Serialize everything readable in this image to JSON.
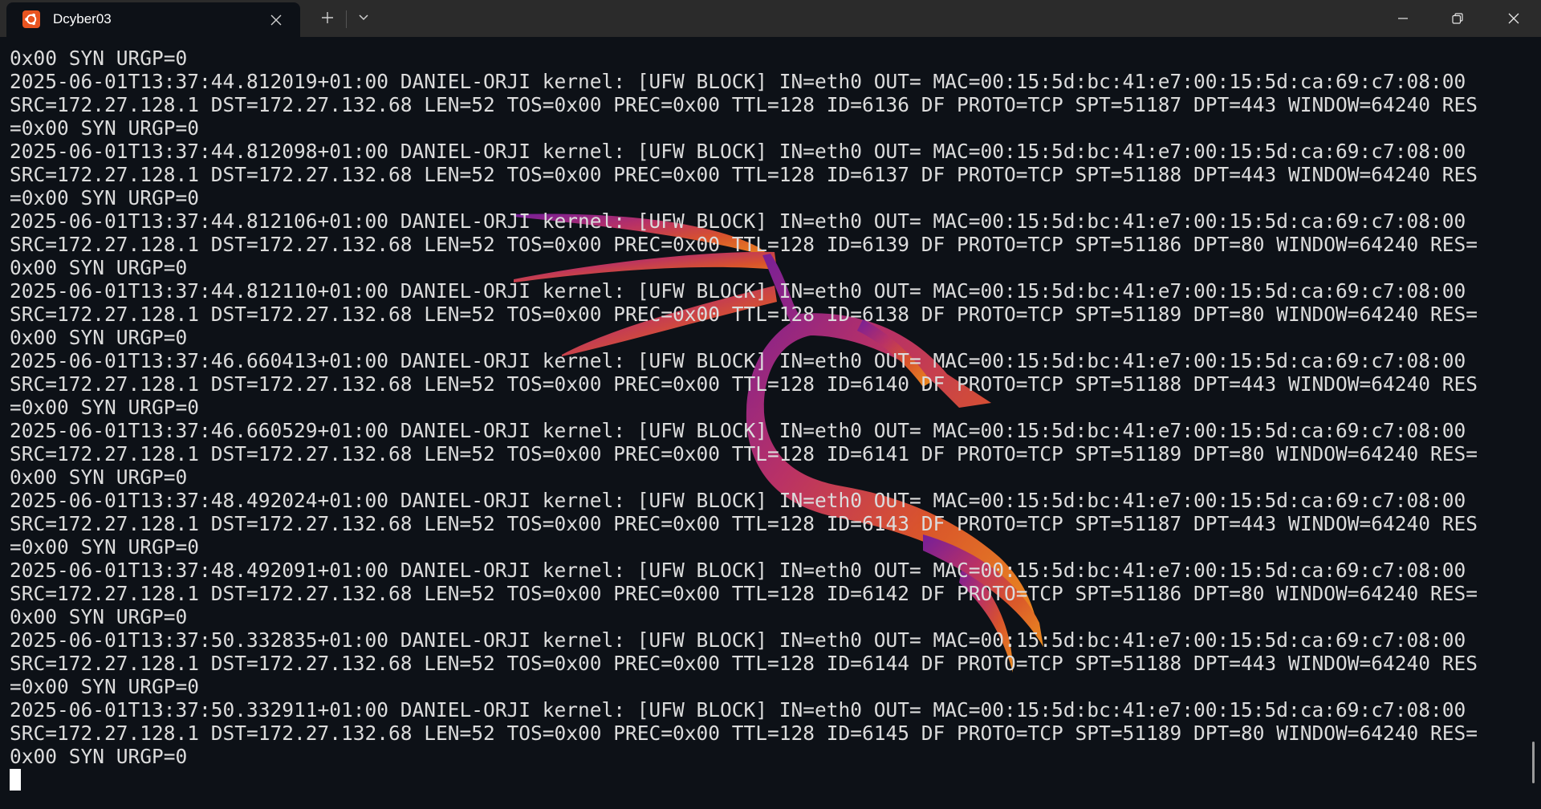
{
  "window": {
    "tab_title": "Dcyber03",
    "tab_icon": "ubuntu-icon",
    "accent_color": "#e95420"
  },
  "terminal": {
    "lines": [
      "0x00 SYN URGP=0",
      "2025-06-01T13:37:44.812019+01:00 DANIEL-ORJI kernel: [UFW BLOCK] IN=eth0 OUT= MAC=00:15:5d:bc:41:e7:00:15:5d:ca:69:c7:08:00",
      "SRC=172.27.128.1 DST=172.27.132.68 LEN=52 TOS=0x00 PREC=0x00 TTL=128 ID=6136 DF PROTO=TCP SPT=51187 DPT=443 WINDOW=64240 RES",
      "=0x00 SYN URGP=0",
      "2025-06-01T13:37:44.812098+01:00 DANIEL-ORJI kernel: [UFW BLOCK] IN=eth0 OUT= MAC=00:15:5d:bc:41:e7:00:15:5d:ca:69:c7:08:00",
      "SRC=172.27.128.1 DST=172.27.132.68 LEN=52 TOS=0x00 PREC=0x00 TTL=128 ID=6137 DF PROTO=TCP SPT=51188 DPT=443 WINDOW=64240 RES",
      "=0x00 SYN URGP=0",
      "2025-06-01T13:37:44.812106+01:00 DANIEL-ORJI kernel: [UFW BLOCK] IN=eth0 OUT= MAC=00:15:5d:bc:41:e7:00:15:5d:ca:69:c7:08:00",
      "SRC=172.27.128.1 DST=172.27.132.68 LEN=52 TOS=0x00 PREC=0x00 TTL=128 ID=6139 DF PROTO=TCP SPT=51186 DPT=80 WINDOW=64240 RES=",
      "0x00 SYN URGP=0",
      "2025-06-01T13:37:44.812110+01:00 DANIEL-ORJI kernel: [UFW BLOCK] IN=eth0 OUT= MAC=00:15:5d:bc:41:e7:00:15:5d:ca:69:c7:08:00",
      "SRC=172.27.128.1 DST=172.27.132.68 LEN=52 TOS=0x00 PREC=0x00 TTL=128 ID=6138 DF PROTO=TCP SPT=51189 DPT=80 WINDOW=64240 RES=",
      "0x00 SYN URGP=0",
      "2025-06-01T13:37:46.660413+01:00 DANIEL-ORJI kernel: [UFW BLOCK] IN=eth0 OUT= MAC=00:15:5d:bc:41:e7:00:15:5d:ca:69:c7:08:00",
      "SRC=172.27.128.1 DST=172.27.132.68 LEN=52 TOS=0x00 PREC=0x00 TTL=128 ID=6140 DF PROTO=TCP SPT=51188 DPT=443 WINDOW=64240 RES",
      "=0x00 SYN URGP=0",
      "2025-06-01T13:37:46.660529+01:00 DANIEL-ORJI kernel: [UFW BLOCK] IN=eth0 OUT= MAC=00:15:5d:bc:41:e7:00:15:5d:ca:69:c7:08:00",
      "SRC=172.27.128.1 DST=172.27.132.68 LEN=52 TOS=0x00 PREC=0x00 TTL=128 ID=6141 DF PROTO=TCP SPT=51189 DPT=80 WINDOW=64240 RES=",
      "0x00 SYN URGP=0",
      "2025-06-01T13:37:48.492024+01:00 DANIEL-ORJI kernel: [UFW BLOCK] IN=eth0 OUT= MAC=00:15:5d:bc:41:e7:00:15:5d:ca:69:c7:08:00",
      "SRC=172.27.128.1 DST=172.27.132.68 LEN=52 TOS=0x00 PREC=0x00 TTL=128 ID=6143 DF PROTO=TCP SPT=51187 DPT=443 WINDOW=64240 RES",
      "=0x00 SYN URGP=0",
      "2025-06-01T13:37:48.492091+01:00 DANIEL-ORJI kernel: [UFW BLOCK] IN=eth0 OUT= MAC=00:15:5d:bc:41:e7:00:15:5d:ca:69:c7:08:00",
      "SRC=172.27.128.1 DST=172.27.132.68 LEN=52 TOS=0x00 PREC=0x00 TTL=128 ID=6142 DF PROTO=TCP SPT=51186 DPT=80 WINDOW=64240 RES=",
      "0x00 SYN URGP=0",
      "2025-06-01T13:37:50.332835+01:00 DANIEL-ORJI kernel: [UFW BLOCK] IN=eth0 OUT= MAC=00:15:5d:bc:41:e7:00:15:5d:ca:69:c7:08:00",
      "SRC=172.27.128.1 DST=172.27.132.68 LEN=52 TOS=0x00 PREC=0x00 TTL=128 ID=6144 DF PROTO=TCP SPT=51188 DPT=443 WINDOW=64240 RES",
      "=0x00 SYN URGP=0",
      "2025-06-01T13:37:50.332911+01:00 DANIEL-ORJI kernel: [UFW BLOCK] IN=eth0 OUT= MAC=00:15:5d:bc:41:e7:00:15:5d:ca:69:c7:08:00",
      "SRC=172.27.128.1 DST=172.27.132.68 LEN=52 TOS=0x00 PREC=0x00 TTL=128 ID=6145 DF PROTO=TCP SPT=51189 DPT=80 WINDOW=64240 RES=",
      "0x00 SYN URGP=0"
    ],
    "background_logo": "kali-dragon-logo",
    "text_color": "#dcdcdc",
    "background_color": "#0d1117"
  }
}
